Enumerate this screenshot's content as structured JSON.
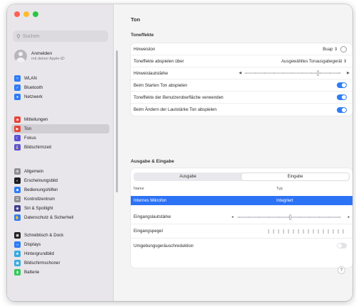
{
  "window": {
    "title": "Ton"
  },
  "search": {
    "placeholder": "Suchen"
  },
  "account": {
    "name": "Anmelden",
    "subtitle": "mit deiner Apple-ID"
  },
  "sidebar": {
    "items": [
      {
        "label": "WLAN",
        "icon": "wifi-icon",
        "color": "#2f7cf6"
      },
      {
        "label": "Bluetooth",
        "icon": "bluetooth-icon",
        "color": "#2f7cf6"
      },
      {
        "label": "Netzwerk",
        "icon": "globe-icon",
        "color": "#2f7cf6"
      },
      {
        "label": "Mitteilungen",
        "icon": "bell-icon",
        "color": "#e8443a"
      },
      {
        "label": "Ton",
        "icon": "speaker-icon",
        "color": "#e8443a",
        "active": true
      },
      {
        "label": "Fokus",
        "icon": "moon-icon",
        "color": "#5b4fd6"
      },
      {
        "label": "Bildschirmzeit",
        "icon": "hourglass-icon",
        "color": "#5b4fd6"
      },
      {
        "label": "Allgemein",
        "icon": "gear-icon",
        "color": "#8e8d92"
      },
      {
        "label": "Erscheinungsbild",
        "icon": "appearance-icon",
        "color": "#1d1d1f"
      },
      {
        "label": "Bedienungshilfen",
        "icon": "accessibility-icon",
        "color": "#2f7cf6"
      },
      {
        "label": "Kontrollzentrum",
        "icon": "control-center-icon",
        "color": "#8e8d92"
      },
      {
        "label": "Siri & Spotlight",
        "icon": "siri-icon",
        "color": "#3b3b8c"
      },
      {
        "label": "Datenschutz & Sicherheit",
        "icon": "hand-icon",
        "color": "#2f7cf6"
      },
      {
        "label": "Schreibtisch & Dock",
        "icon": "dock-icon",
        "color": "#1d1d1f"
      },
      {
        "label": "Displays",
        "icon": "display-icon",
        "color": "#2f7cf6"
      },
      {
        "label": "Hintergrundbild",
        "icon": "wallpaper-icon",
        "color": "#35a8e0"
      },
      {
        "label": "Bildschirmschoner",
        "icon": "screensaver-icon",
        "color": "#35a8e0"
      },
      {
        "label": "Batterie",
        "icon": "battery-icon",
        "color": "#34c759"
      }
    ]
  },
  "effects": {
    "heading": "Toneffekte",
    "alert_sound_label": "Hinweiston",
    "alert_sound_value": "Buap ⇕",
    "play_through_label": "Toneffekte abspielen über",
    "play_through_value": "Ausgewähltes Tonausgabegerät ⇕",
    "alert_volume_label": "Hinweislautstärke",
    "alert_volume_level": 0.75,
    "startup_label": "Beim Starten Ton abspielen",
    "startup_on": true,
    "ui_sounds_label": "Toneffekte der Benutzeroberfläche verwenden",
    "ui_sounds_on": true,
    "volume_feedback_label": "Beim Ändern der Lautstärke Ton abspielen",
    "volume_feedback_on": true
  },
  "io": {
    "heading": "Ausgabe & Eingabe",
    "tabs": [
      "Ausgabe",
      "Eingabe"
    ],
    "selected_tab": "Eingabe",
    "col_name": "Name",
    "col_type": "Typ",
    "device_name": "Internes Mikrofon",
    "device_type": "Integriert",
    "input_volume_label": "Eingangslautstärke",
    "input_volume_level": 0.5,
    "input_level_label": "Eingangspegel",
    "noise_reduction_label": "Umgebungsgeräuschreduktion",
    "noise_reduction_on": false
  },
  "help": {
    "label": "?"
  }
}
